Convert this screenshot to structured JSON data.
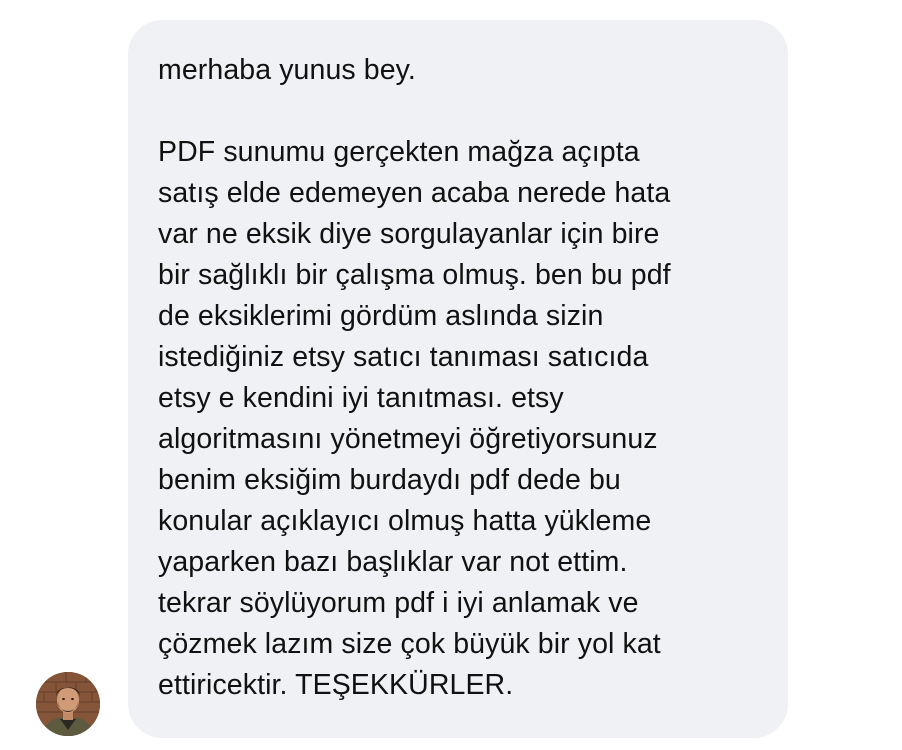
{
  "message": {
    "greeting": "merhaba yunus bey.",
    "lines": [
      "PDF sunumu gerçekten mağza açıpta",
      "satış elde edemeyen acaba nerede hata",
      "var ne eksik diye sorgulayanlar için bire",
      "bir sağlıklı bir çalışma olmuş. ben bu pdf",
      "de eksiklerimi gördüm aslında sizin",
      "istediğiniz etsy satıcı tanıması satıcıda",
      "etsy e kendini iyi tanıtması. etsy",
      "algoritmasını yönetmeyi öğretiyorsunuz",
      "benim eksiğim burdaydı pdf dede bu",
      "konular açıklayıcı olmuş hatta yükleme",
      "yaparken bazı başlıklar var not ettim.",
      "tekrar söylüyorum pdf i iyi anlamak ve",
      "çözmek lazım size çok büyük bir yol kat",
      "ettiricektir. TEŞEKKÜRLER."
    ]
  },
  "sender": {
    "avatar_icon": "user-avatar-photo"
  },
  "colors": {
    "bubble_background": "#f0f1f4",
    "text": "#111111"
  }
}
